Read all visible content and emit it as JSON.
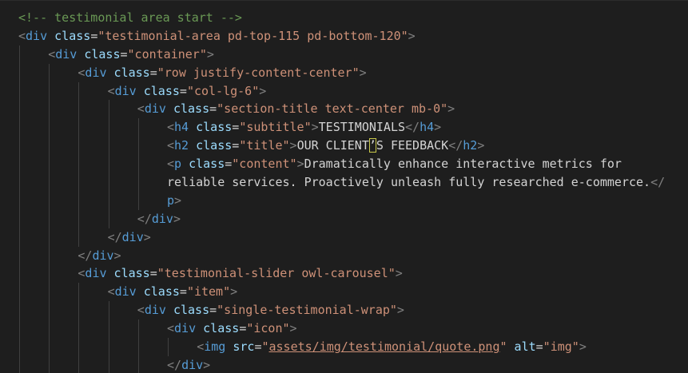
{
  "editor": {
    "lines": [
      {
        "indent": 0,
        "tokens": [
          {
            "t": "comment",
            "v": "<!-- testimonial area start -->"
          }
        ]
      },
      {
        "indent": 0,
        "tokens": [
          {
            "t": "bracket",
            "v": "<"
          },
          {
            "t": "tag",
            "v": "div"
          },
          {
            "t": "text",
            "v": " "
          },
          {
            "t": "attr",
            "v": "class"
          },
          {
            "t": "eq",
            "v": "="
          },
          {
            "t": "str",
            "v": "\"testimonial-area pd-top-115 pd-bottom-120\""
          },
          {
            "t": "bracket",
            "v": ">"
          }
        ]
      },
      {
        "indent": 1,
        "tokens": [
          {
            "t": "bracket",
            "v": "<"
          },
          {
            "t": "tag",
            "v": "div"
          },
          {
            "t": "text",
            "v": " "
          },
          {
            "t": "attr",
            "v": "class"
          },
          {
            "t": "eq",
            "v": "="
          },
          {
            "t": "str",
            "v": "\"container\""
          },
          {
            "t": "bracket",
            "v": ">"
          }
        ]
      },
      {
        "indent": 2,
        "tokens": [
          {
            "t": "bracket",
            "v": "<"
          },
          {
            "t": "tag",
            "v": "div"
          },
          {
            "t": "text",
            "v": " "
          },
          {
            "t": "attr",
            "v": "class"
          },
          {
            "t": "eq",
            "v": "="
          },
          {
            "t": "str",
            "v": "\"row justify-content-center\""
          },
          {
            "t": "bracket",
            "v": ">"
          }
        ]
      },
      {
        "indent": 3,
        "tokens": [
          {
            "t": "bracket",
            "v": "<"
          },
          {
            "t": "tag",
            "v": "div"
          },
          {
            "t": "text",
            "v": " "
          },
          {
            "t": "attr",
            "v": "class"
          },
          {
            "t": "eq",
            "v": "="
          },
          {
            "t": "str",
            "v": "\"col-lg-6\""
          },
          {
            "t": "bracket",
            "v": ">"
          }
        ]
      },
      {
        "indent": 4,
        "tokens": [
          {
            "t": "bracket",
            "v": "<"
          },
          {
            "t": "tag",
            "v": "div"
          },
          {
            "t": "text",
            "v": " "
          },
          {
            "t": "attr",
            "v": "class"
          },
          {
            "t": "eq",
            "v": "="
          },
          {
            "t": "str",
            "v": "\"section-title text-center mb-0\""
          },
          {
            "t": "bracket",
            "v": ">"
          }
        ]
      },
      {
        "indent": 5,
        "tokens": [
          {
            "t": "bracket",
            "v": "<"
          },
          {
            "t": "tag",
            "v": "h4"
          },
          {
            "t": "text",
            "v": " "
          },
          {
            "t": "attr",
            "v": "class"
          },
          {
            "t": "eq",
            "v": "="
          },
          {
            "t": "str",
            "v": "\"subtitle\""
          },
          {
            "t": "bracket",
            "v": ">"
          },
          {
            "t": "text",
            "v": "TESTIMONIALS"
          },
          {
            "t": "bracket",
            "v": "</"
          },
          {
            "t": "tag",
            "v": "h4"
          },
          {
            "t": "bracket",
            "v": ">"
          }
        ]
      },
      {
        "indent": 5,
        "tokens": [
          {
            "t": "bracket",
            "v": "<"
          },
          {
            "t": "tag",
            "v": "h2"
          },
          {
            "t": "text",
            "v": " "
          },
          {
            "t": "attr",
            "v": "class"
          },
          {
            "t": "eq",
            "v": "="
          },
          {
            "t": "str",
            "v": "\"title\""
          },
          {
            "t": "bracket",
            "v": ">"
          },
          {
            "t": "text",
            "v": "OUR CLIENT"
          },
          {
            "t": "cursor",
            "v": "’"
          },
          {
            "t": "text",
            "v": "S FEEDBACK"
          },
          {
            "t": "bracket",
            "v": "</"
          },
          {
            "t": "tag",
            "v": "h2"
          },
          {
            "t": "bracket",
            "v": ">"
          }
        ]
      },
      {
        "indent": 5,
        "tokens": [
          {
            "t": "bracket",
            "v": "<"
          },
          {
            "t": "tag",
            "v": "p"
          },
          {
            "t": "text",
            "v": " "
          },
          {
            "t": "attr",
            "v": "class"
          },
          {
            "t": "eq",
            "v": "="
          },
          {
            "t": "str",
            "v": "\"content\""
          },
          {
            "t": "bracket",
            "v": ">"
          },
          {
            "t": "text",
            "v": "Dramatically enhance interactive metrics for"
          }
        ]
      },
      {
        "indent": 5,
        "tokens": [
          {
            "t": "text",
            "v": "reliable services. Proactively unleash fully researched e-commerce."
          },
          {
            "t": "bracket",
            "v": "</"
          }
        ]
      },
      {
        "indent": 5,
        "tokens": [
          {
            "t": "tag",
            "v": "p"
          },
          {
            "t": "bracket",
            "v": ">"
          }
        ]
      },
      {
        "indent": 4,
        "tokens": [
          {
            "t": "bracket",
            "v": "</"
          },
          {
            "t": "tag",
            "v": "div"
          },
          {
            "t": "bracket",
            "v": ">"
          }
        ]
      },
      {
        "indent": 3,
        "tokens": [
          {
            "t": "bracket",
            "v": "</"
          },
          {
            "t": "tag",
            "v": "div"
          },
          {
            "t": "bracket",
            "v": ">"
          }
        ]
      },
      {
        "indent": 2,
        "tokens": [
          {
            "t": "bracket",
            "v": "</"
          },
          {
            "t": "tag",
            "v": "div"
          },
          {
            "t": "bracket",
            "v": ">"
          }
        ]
      },
      {
        "indent": 2,
        "tokens": [
          {
            "t": "bracket",
            "v": "<"
          },
          {
            "t": "tag",
            "v": "div"
          },
          {
            "t": "text",
            "v": " "
          },
          {
            "t": "attr",
            "v": "class"
          },
          {
            "t": "eq",
            "v": "="
          },
          {
            "t": "str",
            "v": "\"testimonial-slider owl-carousel\""
          },
          {
            "t": "bracket",
            "v": ">"
          }
        ]
      },
      {
        "indent": 3,
        "tokens": [
          {
            "t": "bracket",
            "v": "<"
          },
          {
            "t": "tag",
            "v": "div"
          },
          {
            "t": "text",
            "v": " "
          },
          {
            "t": "attr",
            "v": "class"
          },
          {
            "t": "eq",
            "v": "="
          },
          {
            "t": "str",
            "v": "\"item\""
          },
          {
            "t": "bracket",
            "v": ">"
          }
        ]
      },
      {
        "indent": 4,
        "tokens": [
          {
            "t": "bracket",
            "v": "<"
          },
          {
            "t": "tag",
            "v": "div"
          },
          {
            "t": "text",
            "v": " "
          },
          {
            "t": "attr",
            "v": "class"
          },
          {
            "t": "eq",
            "v": "="
          },
          {
            "t": "str",
            "v": "\"single-testimonial-wrap\""
          },
          {
            "t": "bracket",
            "v": ">"
          }
        ]
      },
      {
        "indent": 5,
        "tokens": [
          {
            "t": "bracket",
            "v": "<"
          },
          {
            "t": "tag",
            "v": "div"
          },
          {
            "t": "text",
            "v": " "
          },
          {
            "t": "attr",
            "v": "class"
          },
          {
            "t": "eq",
            "v": "="
          },
          {
            "t": "str",
            "v": "\"icon\""
          },
          {
            "t": "bracket",
            "v": ">"
          }
        ]
      },
      {
        "indent": 6,
        "tokens": [
          {
            "t": "bracket",
            "v": "<"
          },
          {
            "t": "tag",
            "v": "img"
          },
          {
            "t": "text",
            "v": " "
          },
          {
            "t": "attr",
            "v": "src"
          },
          {
            "t": "eq",
            "v": "="
          },
          {
            "t": "str",
            "v": "\""
          },
          {
            "t": "link",
            "v": "assets/img/testimonial/quote.png"
          },
          {
            "t": "str",
            "v": "\""
          },
          {
            "t": "text",
            "v": " "
          },
          {
            "t": "attr",
            "v": "alt"
          },
          {
            "t": "eq",
            "v": "="
          },
          {
            "t": "str",
            "v": "\"img\""
          },
          {
            "t": "bracket",
            "v": ">"
          }
        ]
      },
      {
        "indent": 5,
        "tokens": [
          {
            "t": "bracket",
            "v": "</"
          },
          {
            "t": "tag",
            "v": "div"
          },
          {
            "t": "bracket",
            "v": ">"
          }
        ]
      }
    ]
  }
}
